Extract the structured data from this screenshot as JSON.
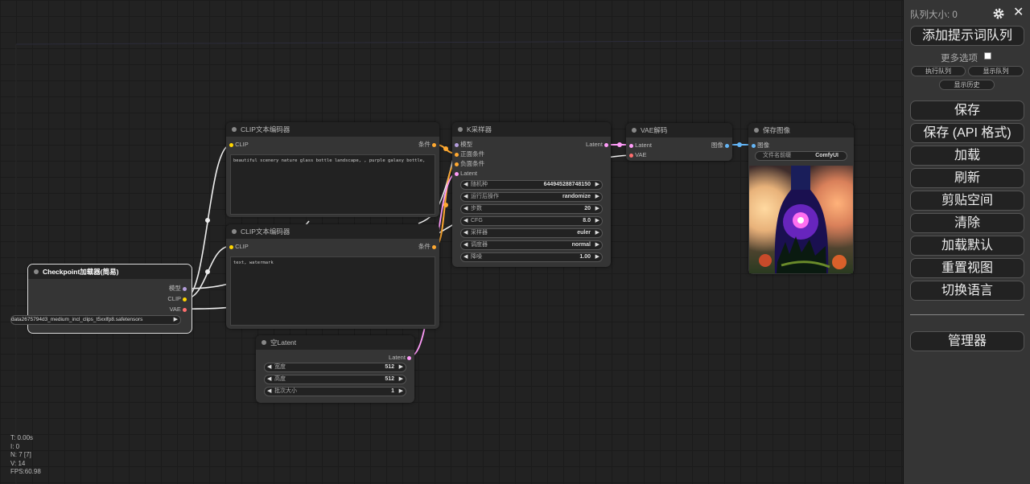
{
  "nodes": {
    "clip1": {
      "title": "CLIP文本编码器",
      "input": "CLIP",
      "output": "条件",
      "text": "beautiful scenery nature glass bottle landscape, , purple galaxy bottle,"
    },
    "clip2": {
      "title": "CLIP文本编码器",
      "input": "CLIP",
      "output": "条件",
      "text": "text, watermark"
    },
    "checkpoint": {
      "title": "Checkpoint加载器(简易)",
      "outputs": [
        "模型",
        "CLIP",
        "VAE"
      ],
      "ckpt_value": "data2675794d3_medium_incl_clips_t5xxlfp8.safetensors"
    },
    "ksampler": {
      "title": "K采样器",
      "inputs": [
        "模型",
        "正面条件",
        "负面条件",
        "Latent"
      ],
      "output": "Latent",
      "widgets": [
        {
          "label": "随机种",
          "value": "644945288748150"
        },
        {
          "label": "运行后操作",
          "value": "randomize"
        },
        {
          "label": "步数",
          "value": "20"
        },
        {
          "label": "CFG",
          "value": "8.0"
        },
        {
          "label": "采样器",
          "value": "euler"
        },
        {
          "label": "调度器",
          "value": "normal"
        },
        {
          "label": "降噪",
          "value": "1.00"
        }
      ]
    },
    "vae": {
      "title": "VAE解码",
      "inputs": [
        "Latent",
        "VAE"
      ],
      "output": "图像"
    },
    "save": {
      "title": "保存图像",
      "input": "图像",
      "prefix_label": "文件名前缀",
      "prefix_value": "ComfyUI"
    },
    "latent": {
      "title": "空Latent",
      "output": "Latent",
      "widgets": [
        {
          "label": "宽度",
          "value": "512"
        },
        {
          "label": "高度",
          "value": "512"
        },
        {
          "label": "批次大小",
          "value": "1"
        }
      ]
    }
  },
  "stats": [
    "T: 0.00s",
    "I: 0",
    "N: 7 [7]",
    "V: 14",
    "FPS:60.98"
  ],
  "menu": {
    "queue_size": "队列大小: 0",
    "close": "✕",
    "queue_prompt": "添加提示词队列",
    "more_options": "更多选项",
    "run_queue": "执行队列",
    "view_queue": "显示队列",
    "view_history": "显示历史",
    "buttons": [
      "保存",
      "保存 (API 格式)",
      "加载",
      "刷新",
      "剪贴空间",
      "清除",
      "加载默认",
      "重置视图",
      "切换语言"
    ],
    "manager": "管理器"
  },
  "colors": {
    "clip": "#ffd500",
    "conditioning": "#ffa931",
    "model": "#b39ddb",
    "vae": "#ff6e6e",
    "latent": "#ff9cf9",
    "image": "#64b5f6"
  }
}
